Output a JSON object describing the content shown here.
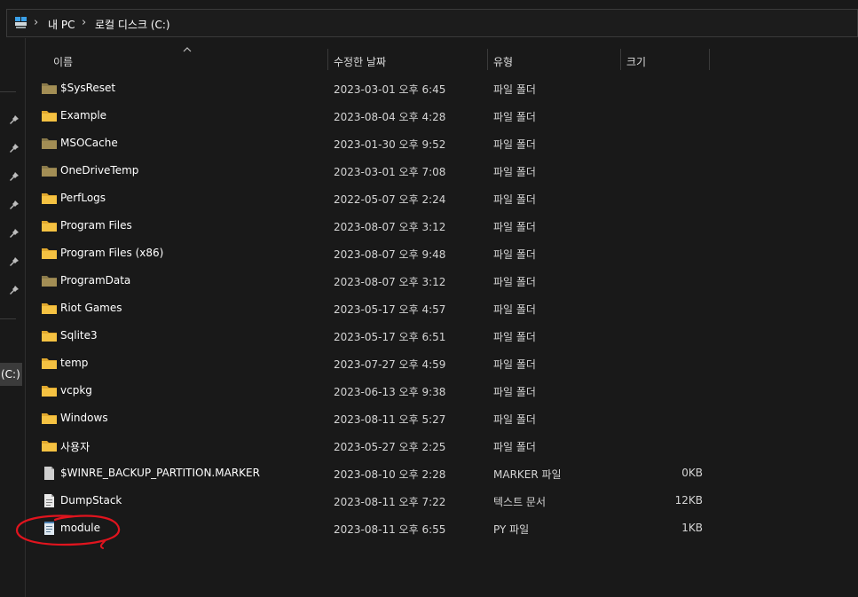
{
  "address_bar": {
    "crumbs": [
      "내 PC",
      "로컬 디스크 (C:)"
    ]
  },
  "left_pane": {
    "drive_label": "(C:)"
  },
  "columns": {
    "name": "이름",
    "date": "수정한 날짜",
    "type": "유형",
    "size": "크기"
  },
  "files": [
    {
      "name": "$SysReset",
      "date": "2023-03-01 오후 6:45",
      "type": "파일 폴더",
      "size": "",
      "icon": "folder-icon-dim"
    },
    {
      "name": "Example",
      "date": "2023-08-04 오후 4:28",
      "type": "파일 폴더",
      "size": "",
      "icon": "folder-icon"
    },
    {
      "name": "MSOCache",
      "date": "2023-01-30 오후 9:52",
      "type": "파일 폴더",
      "size": "",
      "icon": "folder-icon-dim"
    },
    {
      "name": "OneDriveTemp",
      "date": "2023-03-01 오후 7:08",
      "type": "파일 폴더",
      "size": "",
      "icon": "folder-icon-dim"
    },
    {
      "name": "PerfLogs",
      "date": "2022-05-07 오후 2:24",
      "type": "파일 폴더",
      "size": "",
      "icon": "folder-icon"
    },
    {
      "name": "Program Files",
      "date": "2023-08-07 오후 3:12",
      "type": "파일 폴더",
      "size": "",
      "icon": "folder-icon"
    },
    {
      "name": "Program Files (x86)",
      "date": "2023-08-07 오후 9:48",
      "type": "파일 폴더",
      "size": "",
      "icon": "folder-icon"
    },
    {
      "name": "ProgramData",
      "date": "2023-08-07 오후 3:12",
      "type": "파일 폴더",
      "size": "",
      "icon": "folder-icon-dim"
    },
    {
      "name": "Riot Games",
      "date": "2023-05-17 오후 4:57",
      "type": "파일 폴더",
      "size": "",
      "icon": "folder-icon"
    },
    {
      "name": "Sqlite3",
      "date": "2023-05-17 오후 6:51",
      "type": "파일 폴더",
      "size": "",
      "icon": "folder-icon"
    },
    {
      "name": "temp",
      "date": "2023-07-27 오후 4:59",
      "type": "파일 폴더",
      "size": "",
      "icon": "folder-icon"
    },
    {
      "name": "vcpkg",
      "date": "2023-06-13 오후 9:38",
      "type": "파일 폴더",
      "size": "",
      "icon": "folder-icon"
    },
    {
      "name": "Windows",
      "date": "2023-08-11 오후 5:27",
      "type": "파일 폴더",
      "size": "",
      "icon": "folder-icon"
    },
    {
      "name": "사용자",
      "date": "2023-05-27 오후 2:25",
      "type": "파일 폴더",
      "size": "",
      "icon": "folder-icon"
    },
    {
      "name": "$WINRE_BACKUP_PARTITION.MARKER",
      "date": "2023-08-10 오후 2:28",
      "type": "MARKER 파일",
      "size": "0KB",
      "icon": "file-icon"
    },
    {
      "name": "DumpStack",
      "date": "2023-08-11 오후 7:22",
      "type": "텍스트 문서",
      "size": "12KB",
      "icon": "text-file-icon"
    },
    {
      "name": "module",
      "date": "2023-08-11 오후 6:55",
      "type": "PY 파일",
      "size": "1KB",
      "icon": "python-file-icon"
    }
  ],
  "colors": {
    "background": "#191919",
    "folder": "#f5c242",
    "folder_dim": "#8a7a4a",
    "annotation": "#e0141e"
  }
}
